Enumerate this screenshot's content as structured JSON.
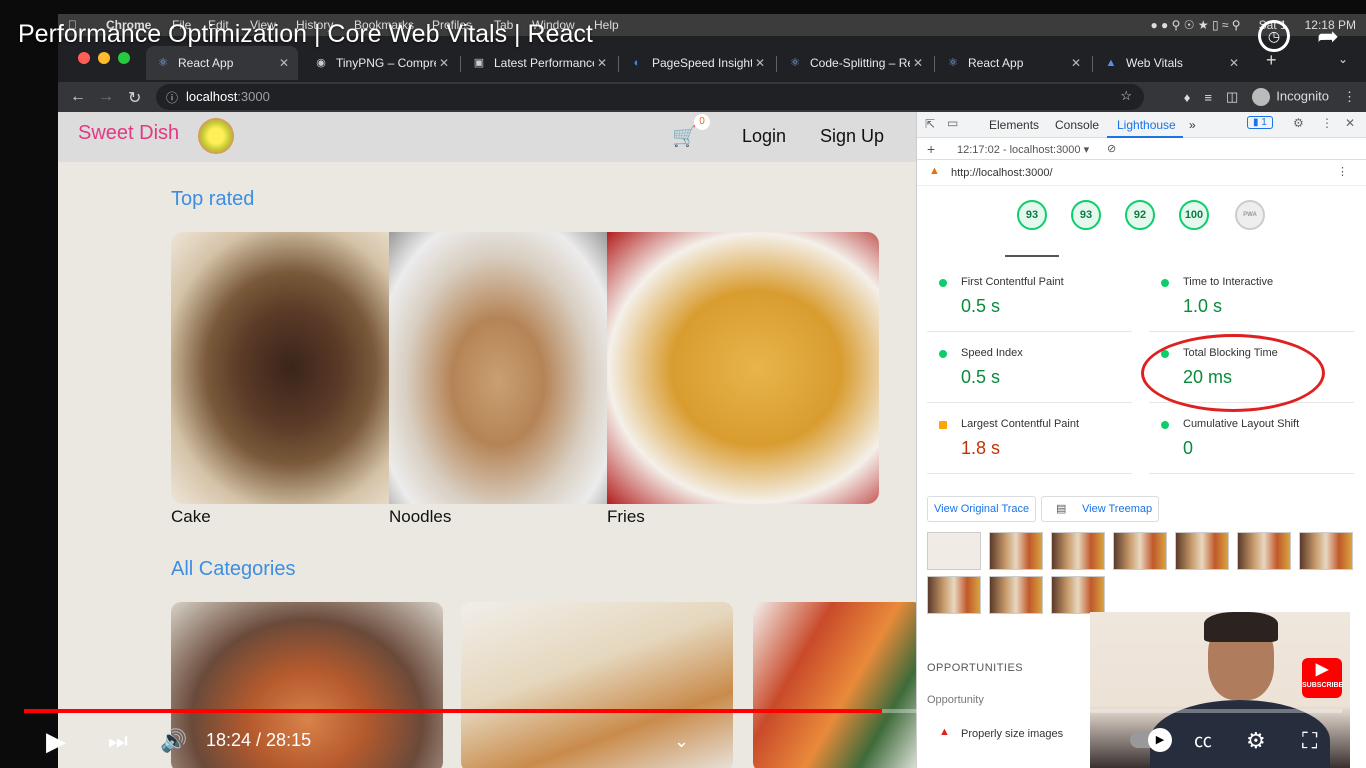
{
  "video": {
    "title": "Performance Optimization | Core Web Vitals | React",
    "current_time": "18:24",
    "duration": "28:15",
    "time_display": "18:24 / 28:15",
    "progress_fraction": 0.651,
    "subscribe_label": "SUBSCRIBE"
  },
  "mac_menubar": {
    "app": "Chrome",
    "items": [
      "File",
      "Edit",
      "View",
      "History",
      "Bookmarks",
      "Profiles",
      "Tab",
      "Window",
      "Help"
    ],
    "clock": "Sat 1",
    "time": "12:18 PM"
  },
  "browser": {
    "tabs": [
      {
        "label": "React App",
        "icon": "react-icon",
        "active": true
      },
      {
        "label": "TinyPNG – Compress",
        "icon": "panda-icon",
        "active": false
      },
      {
        "label": "Latest Performance",
        "icon": "laptop-icon",
        "active": false
      },
      {
        "label": "PageSpeed Insights",
        "icon": "pagespeed-icon",
        "active": false
      },
      {
        "label": "Code-Splitting – Re",
        "icon": "react-icon",
        "active": false
      },
      {
        "label": "React App",
        "icon": "react-icon",
        "active": false
      },
      {
        "label": "Web Vitals",
        "icon": "web-vitals-icon",
        "active": false
      }
    ],
    "new_tab": "+",
    "url_host": "localhost",
    "url_port": ":3000",
    "profile": "Incognito"
  },
  "site": {
    "brand": "Sweet Dish",
    "cart_count": "0",
    "login": "Login",
    "signup": "Sign Up",
    "top_rated_title": "Top rated",
    "top_rated": [
      {
        "caption": "Cake"
      },
      {
        "caption": "Noodles"
      },
      {
        "caption": "Fries"
      }
    ],
    "all_categories_title": "All Categories"
  },
  "devtools": {
    "tabs": [
      "Elements",
      "Console",
      "Lighthouse",
      "»"
    ],
    "active_tab": "Lighthouse",
    "issues_count": "1",
    "report_select": "12:17:02 - localhost:3000",
    "report_url": "http://localhost:3000/",
    "scores": [
      "93",
      "93",
      "92",
      "100"
    ],
    "pwa_label": "PWA",
    "metrics": [
      {
        "label": "First Contentful Paint",
        "value": "0.5 s",
        "status": "pass"
      },
      {
        "label": "Time to Interactive",
        "value": "1.0 s",
        "status": "pass"
      },
      {
        "label": "Speed Index",
        "value": "0.5 s",
        "status": "pass"
      },
      {
        "label": "Total Blocking Time",
        "value": "20 ms",
        "status": "pass"
      },
      {
        "label": "Largest Contentful Paint",
        "value": "1.8 s",
        "status": "average"
      },
      {
        "label": "Cumulative Layout Shift",
        "value": "0",
        "status": "pass"
      }
    ],
    "view_trace": "View Original Trace",
    "view_treemap": "View Treemap",
    "opportunities_heading": "OPPORTUNITIES",
    "opportunity_col": "Opportunity",
    "opportunity_row": "Properly size images"
  },
  "colors": {
    "pass": "#0cce6b",
    "average": "#ffa400",
    "fail": "#ff4e42",
    "brand_pink": "#e23a82",
    "section_blue": "#3d8ee0",
    "progress_red": "#ff0000"
  }
}
